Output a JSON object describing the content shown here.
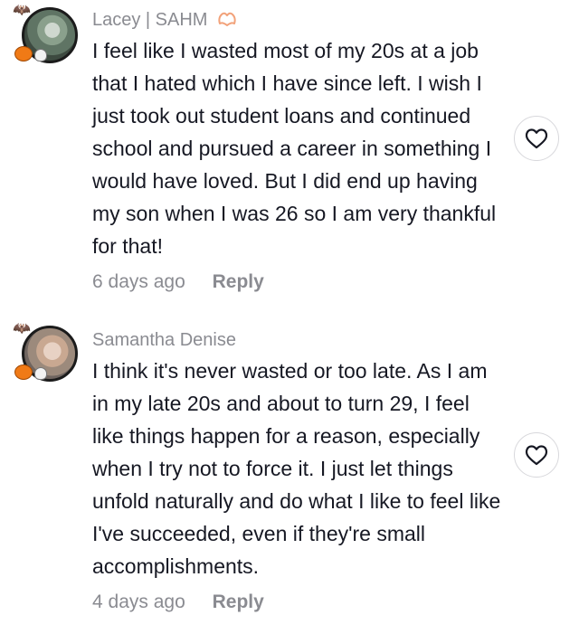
{
  "comments": [
    {
      "author": "Lacey | SAHM",
      "author_badge": "heart-hands-emoji",
      "text": "I feel like I wasted most of my 20s at a job that I hated which I have since left. I wish I just took out student loans and continued school and pursued a career in something I would have loved. But I did end up having my son when I was 26 so I am very thankful for that!",
      "time": "6 days ago",
      "reply_label": "Reply",
      "like_icon": "heart-outline-icon"
    },
    {
      "author": "Samantha Denise",
      "text": "I think it's never wasted or too late. As I am in my late 20s and about to turn 29, I feel like things happen for a reason, especially when I try not to force it. I just let things unfold naturally and do what I like to feel like I've succeeded, even if they're small accomplishments.",
      "time": "4 days ago",
      "reply_label": "Reply",
      "like_icon": "heart-outline-icon"
    }
  ],
  "colors": {
    "text": "#161823",
    "muted": "#8a8b91",
    "badge": "#f2a27a"
  }
}
